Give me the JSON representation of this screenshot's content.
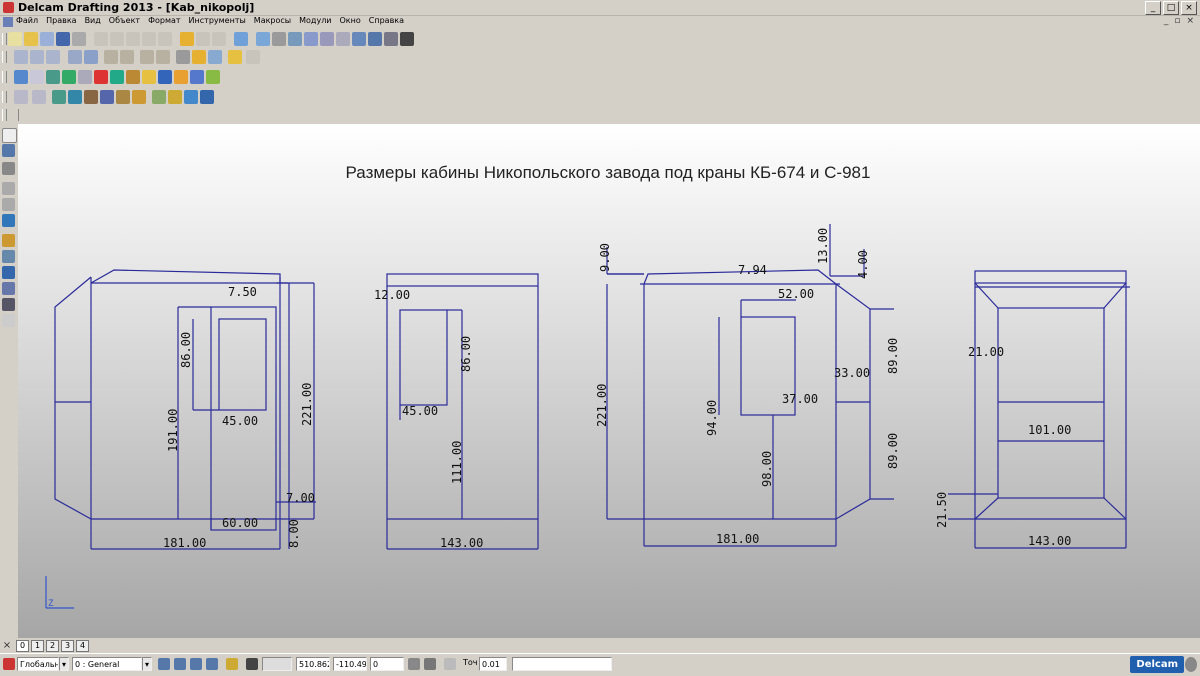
{
  "window": {
    "title": "Delcam Drafting 2013 - [Kab_nikopolj]"
  },
  "menu": [
    "Файл",
    "Правка",
    "Вид",
    "Объект",
    "Формат",
    "Инструменты",
    "Макросы",
    "Модули",
    "Окно",
    "Справка"
  ],
  "drawing": {
    "title": "Размеры кабины Никопольского завода под краны КБ-674 и С-981",
    "axis_label": "Z",
    "views": [
      {
        "name": "left-side-view",
        "dims": [
          "7.50",
          "86.00",
          "191.00",
          "45.00",
          "221.00",
          "7.00",
          "60.00",
          "8.00",
          "181.00"
        ]
      },
      {
        "name": "door-view",
        "dims": [
          "12.00",
          "86.00",
          "45.00",
          "111.00",
          "143.00"
        ]
      },
      {
        "name": "right-side-view",
        "dims": [
          "9.00",
          "13.00",
          "7.94",
          "4.00",
          "52.00",
          "221.00",
          "89.00",
          "33.00",
          "37.00",
          "94.00",
          "98.00",
          "89.00",
          "181.00"
        ]
      },
      {
        "name": "front-view",
        "dims": [
          "21.00",
          "101.00",
          "21.50",
          "143.00"
        ]
      }
    ]
  },
  "page_tabs": [
    "0",
    "1",
    "2",
    "3",
    "4"
  ],
  "status": {
    "scope": "Глобальна",
    "level": "0",
    "layer": "0 : General",
    "coord_x": "510.862",
    "coord_y": "-110.49",
    "coord_z": "0",
    "precision_label": "Точ",
    "precision": "0.01",
    "logo": "Delcam"
  },
  "colors": {
    "line": "#2a2a9a",
    "text": "#111111",
    "chrome": "#d4d0c8"
  }
}
